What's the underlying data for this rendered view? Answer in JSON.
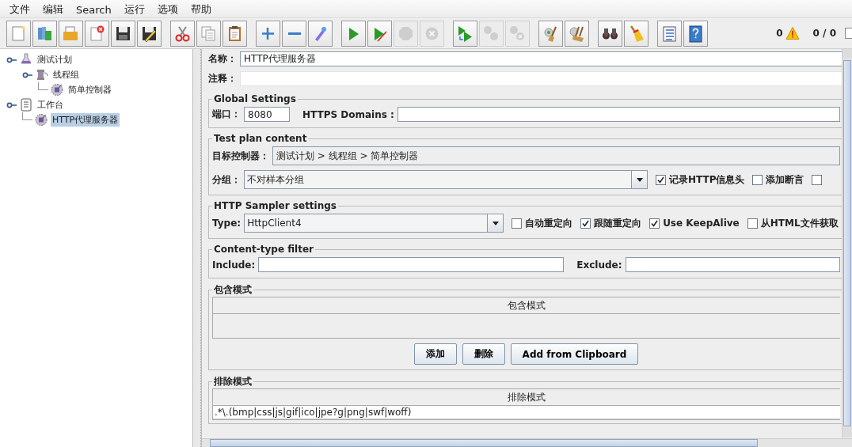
{
  "menu": [
    "文件",
    "编辑",
    "Search",
    "运行",
    "选项",
    "帮助"
  ],
  "toolbar": {
    "groups": [
      [
        {
          "kind": "new",
          "disabled": false
        },
        {
          "kind": "templates",
          "disabled": false
        },
        {
          "kind": "open",
          "disabled": false
        },
        {
          "kind": "close",
          "disabled": false
        },
        {
          "kind": "save",
          "disabled": false
        },
        {
          "kind": "saveas",
          "disabled": false
        }
      ],
      [
        {
          "kind": "cut",
          "disabled": false
        },
        {
          "kind": "copy",
          "disabled": false
        },
        {
          "kind": "paste",
          "disabled": false
        }
      ],
      [
        {
          "kind": "expand",
          "disabled": false
        },
        {
          "kind": "collapse",
          "disabled": false
        },
        {
          "kind": "toggle",
          "disabled": false
        }
      ],
      [
        {
          "kind": "start",
          "disabled": false
        },
        {
          "kind": "start_no_pause",
          "disabled": false
        },
        {
          "kind": "stop",
          "disabled": true
        },
        {
          "kind": "shutdown",
          "disabled": true
        }
      ],
      [
        {
          "kind": "remote_start",
          "disabled": false
        },
        {
          "kind": "remote_stop",
          "disabled": true
        },
        {
          "kind": "remote_shutdown",
          "disabled": true
        }
      ],
      [
        {
          "kind": "clear",
          "disabled": false
        },
        {
          "kind": "clear_all",
          "disabled": false
        }
      ],
      [
        {
          "kind": "search",
          "disabled": false
        },
        {
          "kind": "reset_search",
          "disabled": false
        }
      ],
      [
        {
          "kind": "functions",
          "disabled": false
        },
        {
          "kind": "help",
          "disabled": false
        }
      ]
    ],
    "error_count": "0",
    "thread_count": "0 / 0",
    "edge_checkbox": {
      "checked": false
    }
  },
  "tree": [
    {
      "label": "测试计划",
      "kind": "plan",
      "selected": false,
      "children": [
        {
          "label": "线程组",
          "kind": "threads",
          "selected": false,
          "children": [
            {
              "label": "简单控制器",
              "kind": "controller",
              "selected": false
            }
          ]
        }
      ]
    },
    {
      "label": "工作台",
      "kind": "workbench",
      "selected": false,
      "children": [
        {
          "label": "HTTP代理服务器",
          "kind": "controller",
          "selected": true
        }
      ]
    }
  ],
  "name": {
    "label": "名称：",
    "value": "HTTP代理服务器"
  },
  "comment": {
    "label": "注释："
  },
  "global_settings": {
    "title": "Global Settings",
    "port_label": "端口：",
    "port": "8080",
    "https_label": "HTTPS Domains :"
  },
  "test_plan": {
    "title": "Test plan content",
    "target_label": "目标控制器：",
    "target": "测试计划 > 线程组 > 简单控制器",
    "group_label": "分组：",
    "group": "不对样本分组",
    "options": [
      {
        "label": "记录HTTP信息头",
        "checked": true
      },
      {
        "label": "添加断言",
        "checked": false
      },
      {
        "checked": false
      }
    ]
  },
  "sampler": {
    "title": "HTTP Sampler settings",
    "type_label": "Type:",
    "type": "HttpClient4",
    "options": [
      {
        "label": "自动重定向",
        "checked": false
      },
      {
        "label": "跟随重定向",
        "checked": true
      },
      {
        "label": "Use KeepAlive",
        "checked": true
      },
      {
        "label": "从HTML文件获取",
        "checked": false
      }
    ]
  },
  "content_filter": {
    "title": "Content-type filter",
    "include_label": "Include:",
    "exclude_label": "Exclude:"
  },
  "include": {
    "title": "包含模式",
    "column": "包含模式",
    "buttons": [
      "添加",
      "删除",
      "Add from Clipboard"
    ]
  },
  "exclude": {
    "title": "排除模式",
    "column": "排除模式",
    "rows": [
      ".*\\.(bmp|css|js|gif|ico|jpe?g|png|swf|woff)"
    ]
  }
}
